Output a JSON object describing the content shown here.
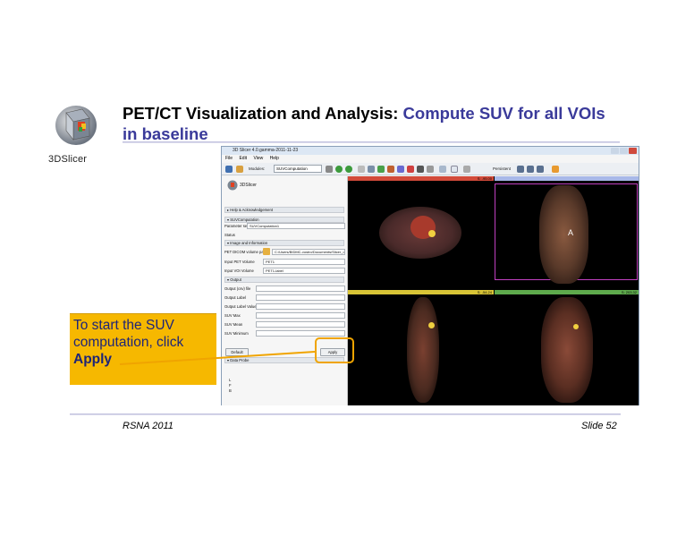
{
  "logo": {
    "text": "3DSlicer"
  },
  "slide": {
    "title_main": "PET/CT Visualization and Analysis: ",
    "title_highlight": "Compute SUV for all VOIs in baseline",
    "footer_left": "RSNA 2011",
    "footer_right": "Slide 52"
  },
  "callout": {
    "line1": "To start the SUV computation, click ",
    "action": "Apply"
  },
  "app": {
    "window_title": "3D Slicer 4.0.gamma-2011-11-23",
    "menu": [
      "File",
      "Edit",
      "View",
      "Help"
    ],
    "toolbar": {
      "modules_label": "Modules:",
      "module_selected": "SUVComputation",
      "persistent_label": "Persistent"
    },
    "panel": {
      "header_logo": "3DSlicer",
      "help_section": "Help & Acknowledgement",
      "suv_section": "SUVComputation",
      "param_set_label": "Parameter set:",
      "param_set_value": "SUVComputation1",
      "status_label": "Status",
      "image_section": "Image and Information",
      "dicom_label": "PET DICOM volume path",
      "dicom_value": "C:/Users/BIDMC-vostro/Documents/Slicer_data/PE",
      "pet_label": "Input PET Volume",
      "pet_value": "PET1",
      "voi_label": "Input VOI Volume",
      "voi_value": "PET1-label",
      "output_section": "Output",
      "output_rows": [
        "Output (csv) file",
        "Output Label",
        "Output Label Value",
        "SUV Max",
        "SUV Mean",
        "SUV Minimum"
      ],
      "default_button": "Default",
      "apply_button": "Apply",
      "data_probe_section": "Data Probe",
      "probe_letters": [
        "L",
        "F",
        "B"
      ]
    },
    "views": {
      "red": {
        "value": "S: -95.00"
      },
      "yellow": {
        "value": "S: -54.24"
      },
      "green": {
        "value": "S: 203.32"
      },
      "three_d_marker": "A"
    }
  },
  "colors": {
    "title_highlight": "#3a3a9a",
    "callout_bg": "#f6b800",
    "callout_text": "#1e2578",
    "ring": "#f0a400",
    "red_view": "#d24a3a",
    "yellow_view": "#d8c436",
    "green_view": "#5eaa4c"
  }
}
